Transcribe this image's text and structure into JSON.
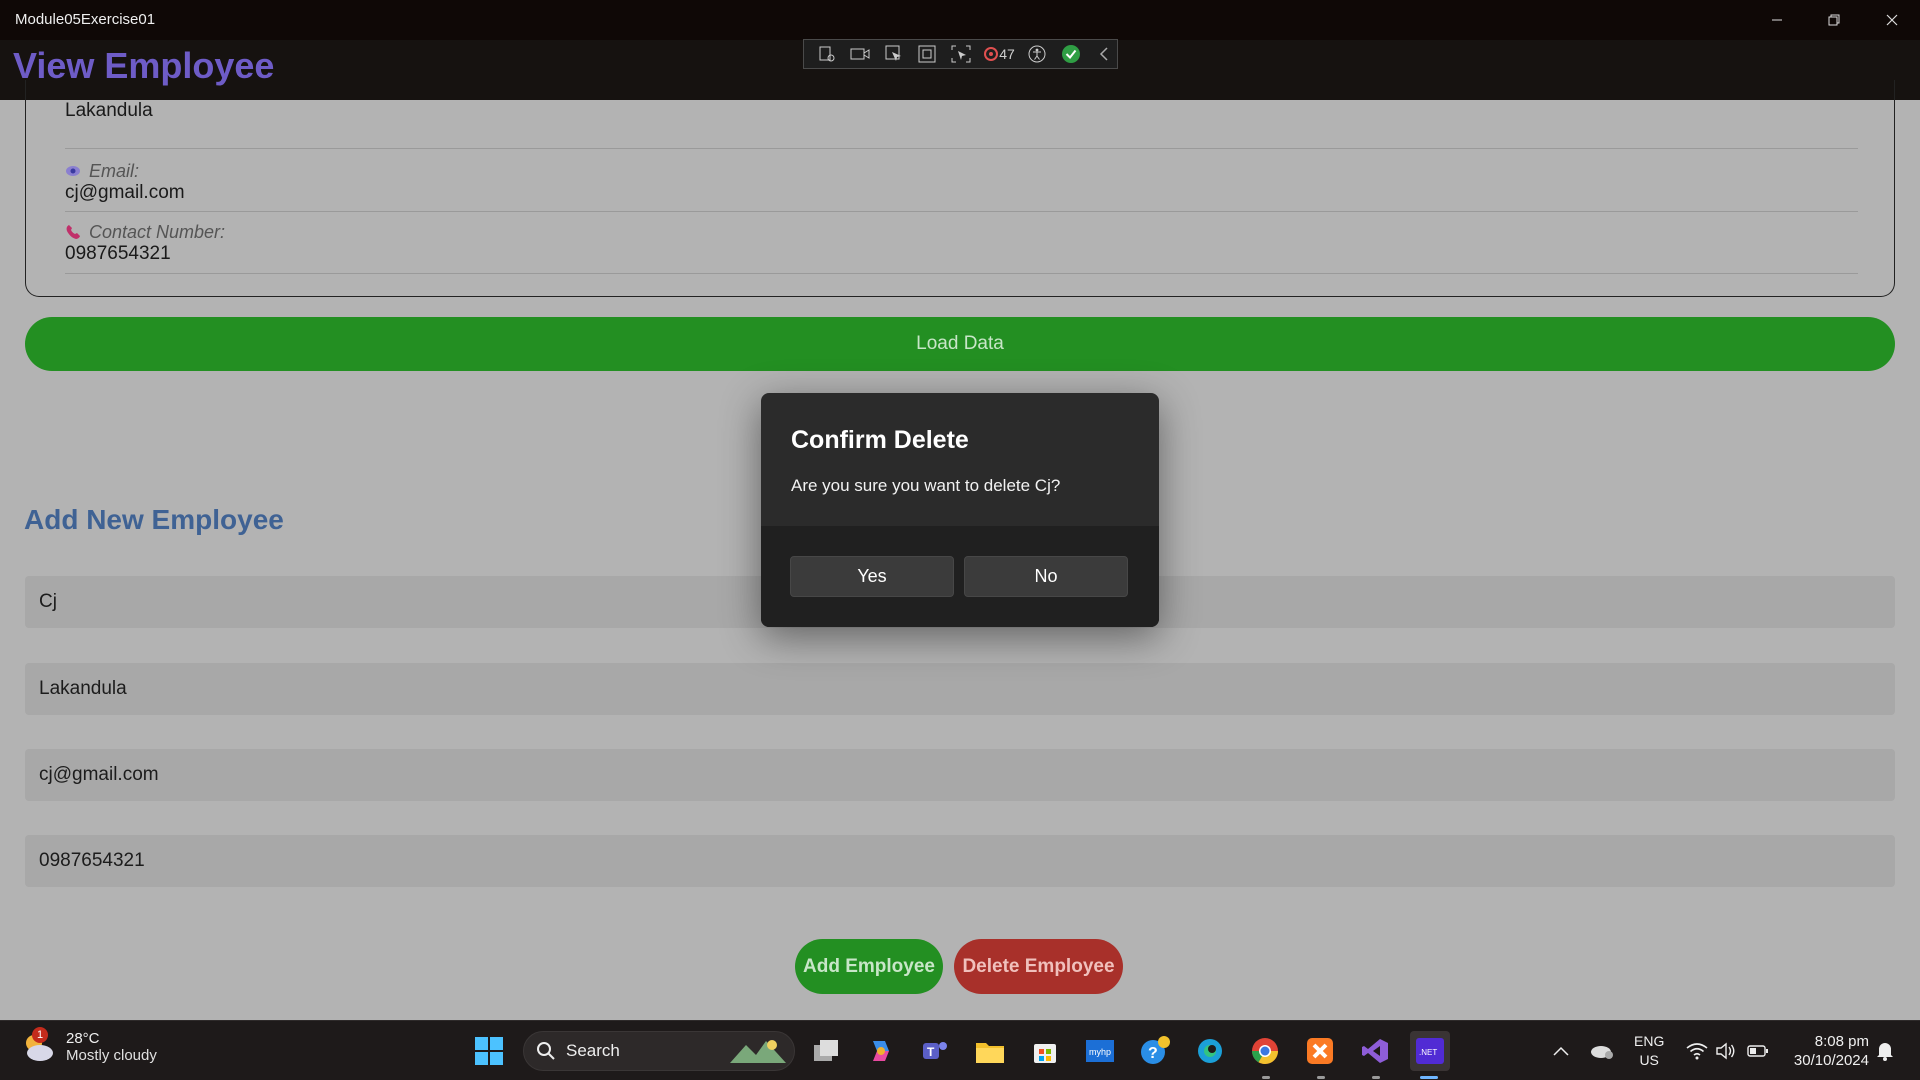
{
  "window": {
    "title": "Module05Exercise01"
  },
  "header": {
    "title": "View Employee"
  },
  "debug_toolbar": {
    "count": "47"
  },
  "employee_card": {
    "last_name": "Lakandula",
    "email_label": "Email:",
    "email": "cj@gmail.com",
    "contact_label": "Contact Number:",
    "contact": "0987654321"
  },
  "load_button": "Load Data",
  "add_section": {
    "title": "Add New Employee",
    "first_name": "Cj",
    "last_name": "Lakandula",
    "email": "cj@gmail.com",
    "contact": "0987654321",
    "add_button": "Add Employee",
    "delete_button": "Delete Employee"
  },
  "dialog": {
    "title": "Confirm Delete",
    "message": "Are you sure you want to delete Cj?",
    "yes": "Yes",
    "no": "No"
  },
  "taskbar": {
    "weather_badge": "1",
    "temperature": "28°C",
    "weather_desc": "Mostly cloudy",
    "search_placeholder": "Search",
    "lang_top": "ENG",
    "lang_bottom": "US",
    "time": "8:08 pm",
    "date": "30/10/2024"
  },
  "colors": {
    "accent_title": "#6e5cc7",
    "green": "#238f22",
    "red": "#a8302a",
    "section_title": "#3f6294"
  }
}
